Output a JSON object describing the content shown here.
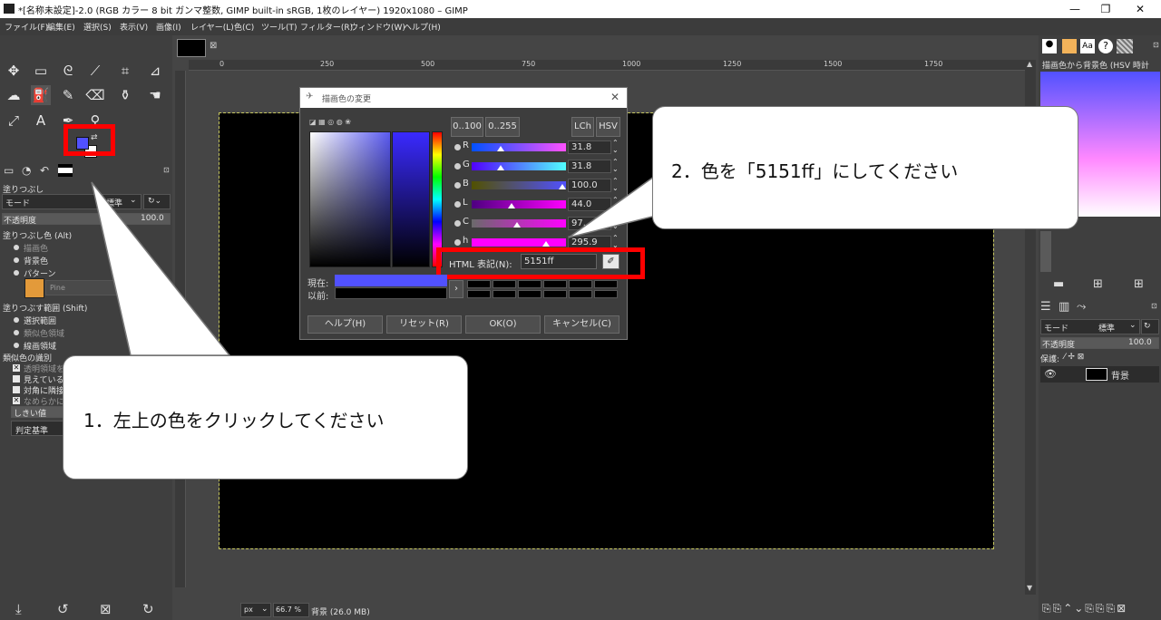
{
  "window": {
    "title": "*[名称未設定]-2.0 (RGB カラー 8 bit ガンマ整数, GIMP built-in sRGB, 1枚のレイヤー) 1920x1080 – GIMP",
    "minimize": "—",
    "maximize": "❐",
    "close": "✕"
  },
  "menubar": {
    "items": [
      "ファイル(F)",
      "編集(E)",
      "選択(S)",
      "表示(V)",
      "画像(I)",
      "レイヤー(L)",
      "色(C)",
      "ツール(T)",
      "フィルター(R)",
      "ウィンドウ(W)",
      "ヘルプ(H)"
    ]
  },
  "tool_options": {
    "title": "塗りつぶし",
    "mode_label": "モード",
    "mode_value": "標準",
    "opacity_label": "不透明度",
    "opacity_value": "100.0",
    "fill_type_label": "塗りつぶし色 (Alt)",
    "fill_fg": "描画色",
    "fill_bg": "背景色",
    "fill_pattern": "パターン",
    "pattern_name": "Pine",
    "area_label": "塗りつぶす範囲 (Shift)",
    "area_selection": "選択範囲",
    "area_similar": "類似色領域",
    "area_line": "線画領域",
    "similar_label": "類似色の識別",
    "opt_transparent": "透明領域を",
    "opt_visible": "見えている",
    "opt_diagonal": "対角に隣接",
    "opt_antialias": "なめらかに",
    "threshold_label": "しきい値",
    "criterion_label": "判定基準"
  },
  "image_tab": {
    "close": "⊠"
  },
  "rulers": {
    "top": [
      "0",
      "250",
      "500",
      "750",
      "1000",
      "1250",
      "1500",
      "1750"
    ],
    "left": [
      "0",
      "2",
      "5",
      "0",
      "5",
      "0",
      "0",
      "0",
      "0",
      "7",
      "5",
      "0",
      "1",
      "0"
    ]
  },
  "dialog": {
    "title": "描画色の変更",
    "close": "✕",
    "range_100": "0..100",
    "range_255": "0..255",
    "lch": "LCh",
    "hsv": "HSV",
    "sliders": [
      {
        "label": "R",
        "value": "31.8",
        "fraction": 0.318
      },
      {
        "label": "G",
        "value": "31.8",
        "fraction": 0.318
      },
      {
        "label": "B",
        "value": "100.0",
        "fraction": 1.0
      },
      {
        "label": "L",
        "value": "44.0",
        "fraction": 0.44
      },
      {
        "label": "C",
        "value": "97.",
        "fraction": 0.5
      },
      {
        "label": "h",
        "value": "295.9",
        "fraction": 0.82
      }
    ],
    "html_label": "HTML 表記(N):",
    "html_value": "5151ff",
    "current_label": "現在:",
    "previous_label": "以前:",
    "current_color": "#5151ff",
    "previous_color": "#000000",
    "help": "ヘルプ(H)",
    "reset": "リセット(R)",
    "ok": "OK(O)",
    "cancel": "キャンセル(C)"
  },
  "right_panel": {
    "gradient_name": "描画色から背景色 (HSV 時計",
    "mode_label": "モード",
    "mode_value": "標準",
    "opacity_label": "不透明度",
    "opacity_value": "100.0",
    "lock_label": "保護:",
    "layer_name": "背景"
  },
  "status": {
    "unit": "px",
    "zoom": "66.7 %",
    "info": "背景 (26.0 MB)"
  },
  "callouts": {
    "step1": "1．左上の色をクリックしてください",
    "step2": "2．色を「5151ff」にしてください"
  },
  "colors": {
    "foreground": "#5151ff",
    "background": "#ffffff",
    "highlight_box": "#ff0000"
  }
}
